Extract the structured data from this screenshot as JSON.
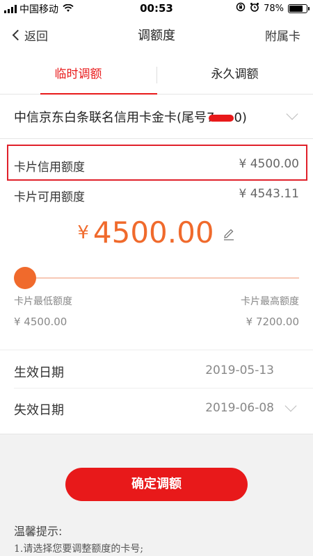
{
  "status_bar": {
    "carrier": "中国移动",
    "time": "00:53",
    "battery": "78%",
    "battery_level": 0.78
  },
  "nav": {
    "back_label": "返回",
    "title": "调额度",
    "right_label": "附属卡"
  },
  "tabs": [
    {
      "label": "临时调额",
      "active": true
    },
    {
      "label": "永久调额",
      "active": false
    }
  ],
  "card": {
    "name": "中信京东白条联名信用卡金卡(尾号7",
    "suffix": "0)"
  },
  "credit_limit": {
    "label": "卡片信用额度",
    "value": "¥ 4500.00"
  },
  "available_limit": {
    "label": "卡片可用额度",
    "value": "¥ 4543.11"
  },
  "amount": {
    "currency": "¥",
    "value": "4500.00"
  },
  "slider": {
    "min_label": "卡片最低额度",
    "max_label": "卡片最高额度",
    "min_value": "¥ 4500.00",
    "max_value": "¥ 7200.00",
    "position": 0.0
  },
  "effective_date": {
    "label": "生效日期",
    "value": "2019-05-13"
  },
  "expiry_date": {
    "label": "失效日期",
    "value": "2019-06-08"
  },
  "confirm_button": "确定调额",
  "tips": {
    "title": "温馨提示:",
    "line1": "1.请选择您要调整额度的卡号;"
  },
  "colors": {
    "accent_red": "#e8191a",
    "amount_orange": "#f06a2c"
  }
}
